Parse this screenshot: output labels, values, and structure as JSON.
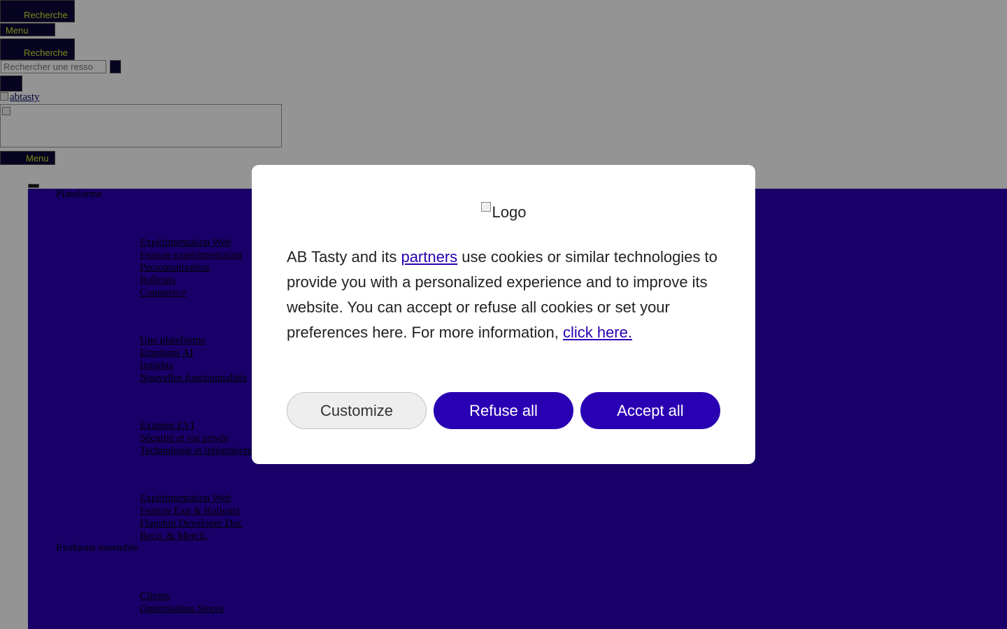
{
  "header": {
    "search_toggle_label": "Recherche",
    "menu_toggle_label": "Menu",
    "search_button_label": "Recherche",
    "search_placeholder": "Rechercher une resso",
    "logo_alt": "abtasty",
    "mobile_menu_label": "Menu"
  },
  "nav": {
    "section_platform": {
      "heading": "Plateforme",
      "group1": [
        "Expérimentation Web",
        "Feature expérimentation",
        "Personnalisation",
        "Rollouts",
        "Commerce"
      ],
      "group2": [
        "Une plateforme",
        "Emotions AI",
        "Insights",
        "Nouvelles fonctionnalités"
      ],
      "group3": [
        "Examen EVI",
        "Sécurité et vie privée",
        "Technologie et intégrations"
      ],
      "group4": [
        "Expérimentation Web",
        "Feature Exp & Rollouts",
        "Flagship Developer Doc",
        "Reco. & Merch."
      ]
    },
    "section_together": {
      "heading": "Evoluons ensemble",
      "group1": [
        "Clients",
        "Optimisation Stores"
      ]
    }
  },
  "cookie_modal": {
    "logo_alt": "Logo",
    "text_before": "AB Tasty and its ",
    "partners_link": "partners",
    "text_after": " use cookies or similar technologies to provide you with a personalized experience and to improve its website. You can accept or refuse all cookies or set your preferences here. For more information, ",
    "more_info_link": "click here.",
    "customize_label": "Customize",
    "refuse_label": "Refuse all",
    "accept_label": "Accept all"
  },
  "colors": {
    "brand": "#2a00b3",
    "dark_button": "#0c0838",
    "button_text": "#d8e830"
  }
}
